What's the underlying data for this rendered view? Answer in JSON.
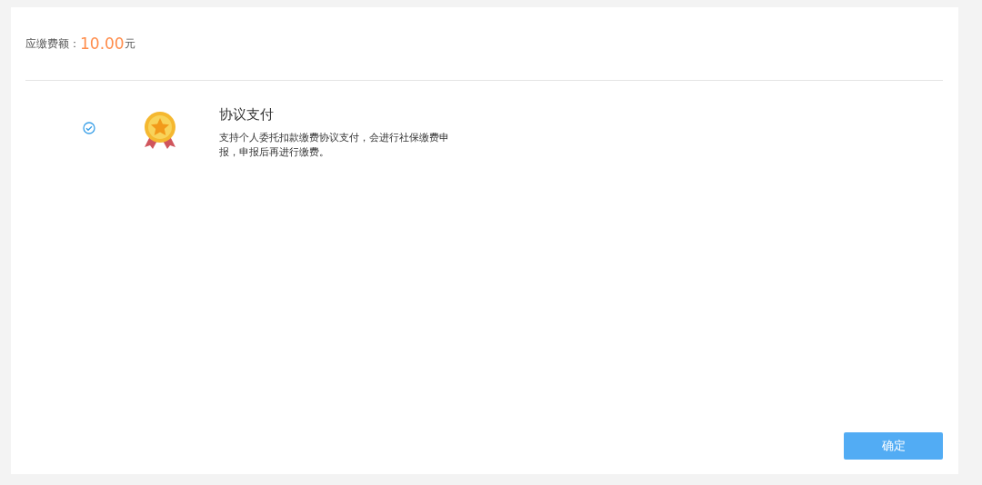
{
  "amount": {
    "label": "应缴费额：",
    "value": "10.00",
    "unit": "元"
  },
  "payment_methods": [
    {
      "title": "协议支付",
      "description": "支持个人委托扣款缴费协议支付，会进行社保缴费申报，申报后再进行缴费。",
      "selected": true
    }
  ],
  "confirm_button": "确定"
}
